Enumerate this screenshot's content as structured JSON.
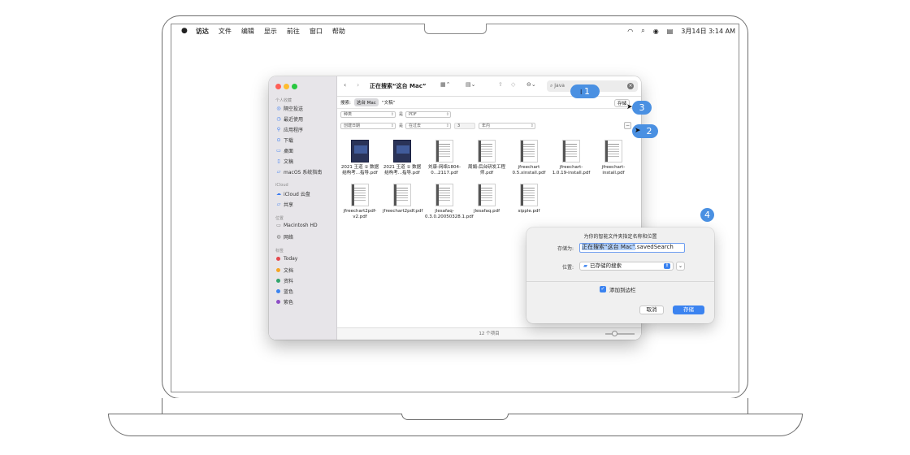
{
  "menubar": {
    "apple_icon": "apple-icon",
    "items": [
      "访达",
      "文件",
      "编辑",
      "显示",
      "前往",
      "窗口",
      "帮助"
    ],
    "datetime": "3月14日  3:14 AM",
    "status_icons": [
      "wifi-icon",
      "search-icon",
      "user-icon",
      "control-center-icon"
    ]
  },
  "finder": {
    "title": "正在搜索“这台 Mac”",
    "search_text": "Java",
    "sidebar": {
      "favorites_header": "个人收藏",
      "favorites": [
        "隔空投送",
        "最近使用",
        "应用程序",
        "下载",
        "桌面",
        "文稿",
        "macOS 系统指南"
      ],
      "icloud_header": "iCloud",
      "icloud": [
        "iCloud 云盘",
        "共享"
      ],
      "locations_header": "位置",
      "locations": [
        "Macintosh HD",
        "网络"
      ],
      "tags_header": "标签",
      "tags": [
        {
          "label": "Today",
          "color": "#e5484d"
        },
        {
          "label": "文档",
          "color": "#f5a524"
        },
        {
          "label": "资料",
          "color": "#30a46c"
        },
        {
          "label": "蓝色",
          "color": "#3b83f0"
        },
        {
          "label": "紫色",
          "color": "#8e4ec6"
        }
      ]
    },
    "scope": {
      "label": "搜索:",
      "this_mac": "这台 Mac",
      "shared": "“文稿”",
      "save_button": "存储"
    },
    "criteria": [
      {
        "attr": "种类",
        "op": "是",
        "value": "PDF",
        "extra": ""
      },
      {
        "attr": "创建日期",
        "op": "是",
        "value": "在过去",
        "extra": "3",
        "unit": "年内"
      }
    ],
    "files": [
      {
        "name": "2021 王道 ① 数据结构考...指导.pdf",
        "kind": "book"
      },
      {
        "name": "2021 王道 ① 数据结构考...指导.pdf",
        "kind": "book"
      },
      {
        "name": "刘康-网络1804-0...2117.pdf",
        "kind": "doc"
      },
      {
        "name": "周娟-后台研发工程师.pdf",
        "kind": "doc"
      },
      {
        "name": "jfreechart 0.5.xinstall.pdf",
        "kind": "doc"
      },
      {
        "name": "jfreechart-1.0.19-install.pdf",
        "kind": "doc"
      },
      {
        "name": "jfreechart-install.pdf",
        "kind": "doc"
      },
      {
        "name": "jfreechart2pdf-v2.pdf",
        "kind": "doc"
      },
      {
        "name": "jfreechart2pdf.pdf",
        "kind": "doc"
      },
      {
        "name": "jlesafaq-0.3.0.20050328.1.pdf",
        "kind": "doc"
      },
      {
        "name": "jlesafaq.pdf",
        "kind": "doc"
      },
      {
        "name": "sipple.pdf",
        "kind": "doc"
      }
    ],
    "item_count": "12 个项目"
  },
  "sheet": {
    "title": "为你的智能文件夹指定名称和位置",
    "save_as_label": "存储为:",
    "filename_selected": "正在搜索“这台 Mac”",
    "filename_ext": ".savedSearch",
    "where_label": "位置:",
    "where_value": "已存储的搜索",
    "add_to_sidebar": "添加到边栏",
    "add_to_sidebar_checked": true,
    "cancel": "取消",
    "save": "存储"
  },
  "callouts": [
    "1",
    "2",
    "3",
    "4"
  ],
  "accent_color": "#4a90e2"
}
